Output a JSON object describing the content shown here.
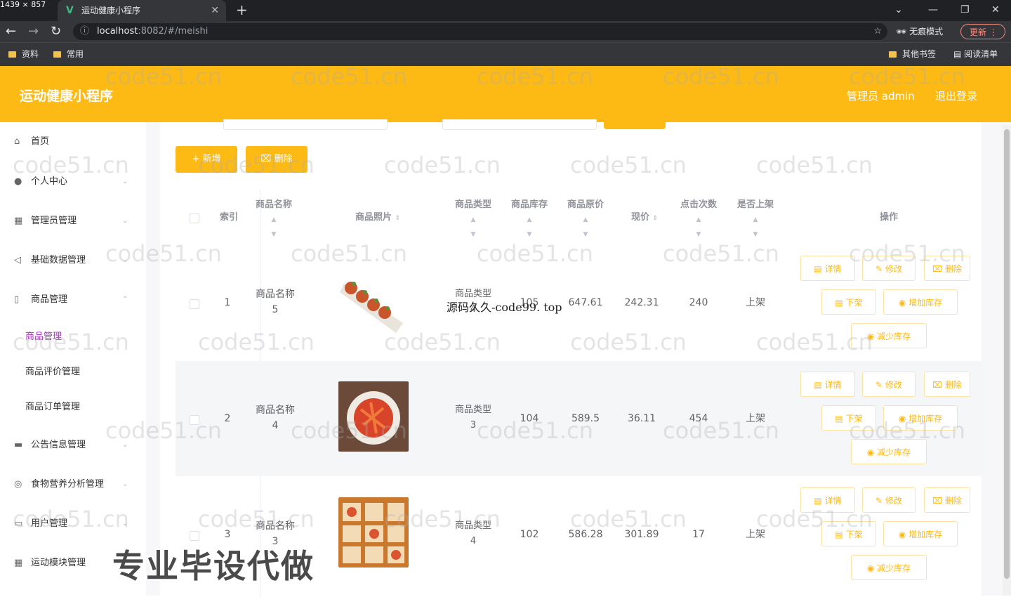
{
  "browser": {
    "dim_label": "1439 × 857",
    "tab_title": "运动健康小程序",
    "url_host": "localhost",
    "url_rest": ":8082/#/meishi",
    "incognito_label": "无痕模式",
    "update_label": "更新",
    "bookmarks": [
      "资料",
      "常用"
    ],
    "bookmarks_right": [
      "其他书签",
      "阅读清单"
    ]
  },
  "header": {
    "brand": "运动健康小程序",
    "user": "管理员 admin",
    "logout": "退出登录"
  },
  "sidebar": {
    "items": [
      {
        "label": "首页"
      },
      {
        "label": "个人中心"
      },
      {
        "label": "管理员管理"
      },
      {
        "label": "基础数据管理"
      },
      {
        "label": "商品管理"
      },
      {
        "label": "公告信息管理"
      },
      {
        "label": "食物营养分析管理"
      },
      {
        "label": "用户管理"
      },
      {
        "label": "运动模块管理"
      }
    ],
    "subitems": [
      "商品管理",
      "商品评价管理",
      "商品订单管理"
    ]
  },
  "toolbar": {
    "add": "+ 新增",
    "delete": "删除"
  },
  "table": {
    "headers": {
      "index": "索引",
      "name": "商品名称",
      "photo": "商品照片",
      "type": "商品类型",
      "stock": "商品库存",
      "orig_price": "商品原价",
      "price": "现价",
      "clicks": "点击次数",
      "onsale": "是否上架",
      "ops": "操作"
    },
    "rows": [
      {
        "index": "1",
        "name_a": "商品名称",
        "name_b": "5",
        "type_a": "商品类型",
        "type_b": "4",
        "stock": "105",
        "orig_price": "647.61",
        "price": "242.31",
        "clicks": "240",
        "onsale": "上架"
      },
      {
        "index": "2",
        "name_a": "商品名称",
        "name_b": "4",
        "type_a": "商品类型",
        "type_b": "3",
        "stock": "104",
        "orig_price": "589.5",
        "price": "36.11",
        "clicks": "454",
        "onsale": "上架"
      },
      {
        "index": "3",
        "name_a": "商品名称",
        "name_b": "3",
        "type_a": "商品类型",
        "type_b": "4",
        "stock": "102",
        "orig_price": "586.28",
        "price": "301.89",
        "clicks": "17",
        "onsale": "上架"
      }
    ],
    "ops": {
      "detail": "详情",
      "edit": "修改",
      "delete": "删除",
      "offsale": "下架",
      "add_stock": "增加库存",
      "reduce_stock": "减少库存"
    }
  },
  "overlays": {
    "watermark": "code51.cn",
    "banner": "专业毕设代做",
    "source": "源码久久-code99. top"
  },
  "colors": {
    "accent": "#fdba14",
    "active_sub": "#a832c2"
  }
}
